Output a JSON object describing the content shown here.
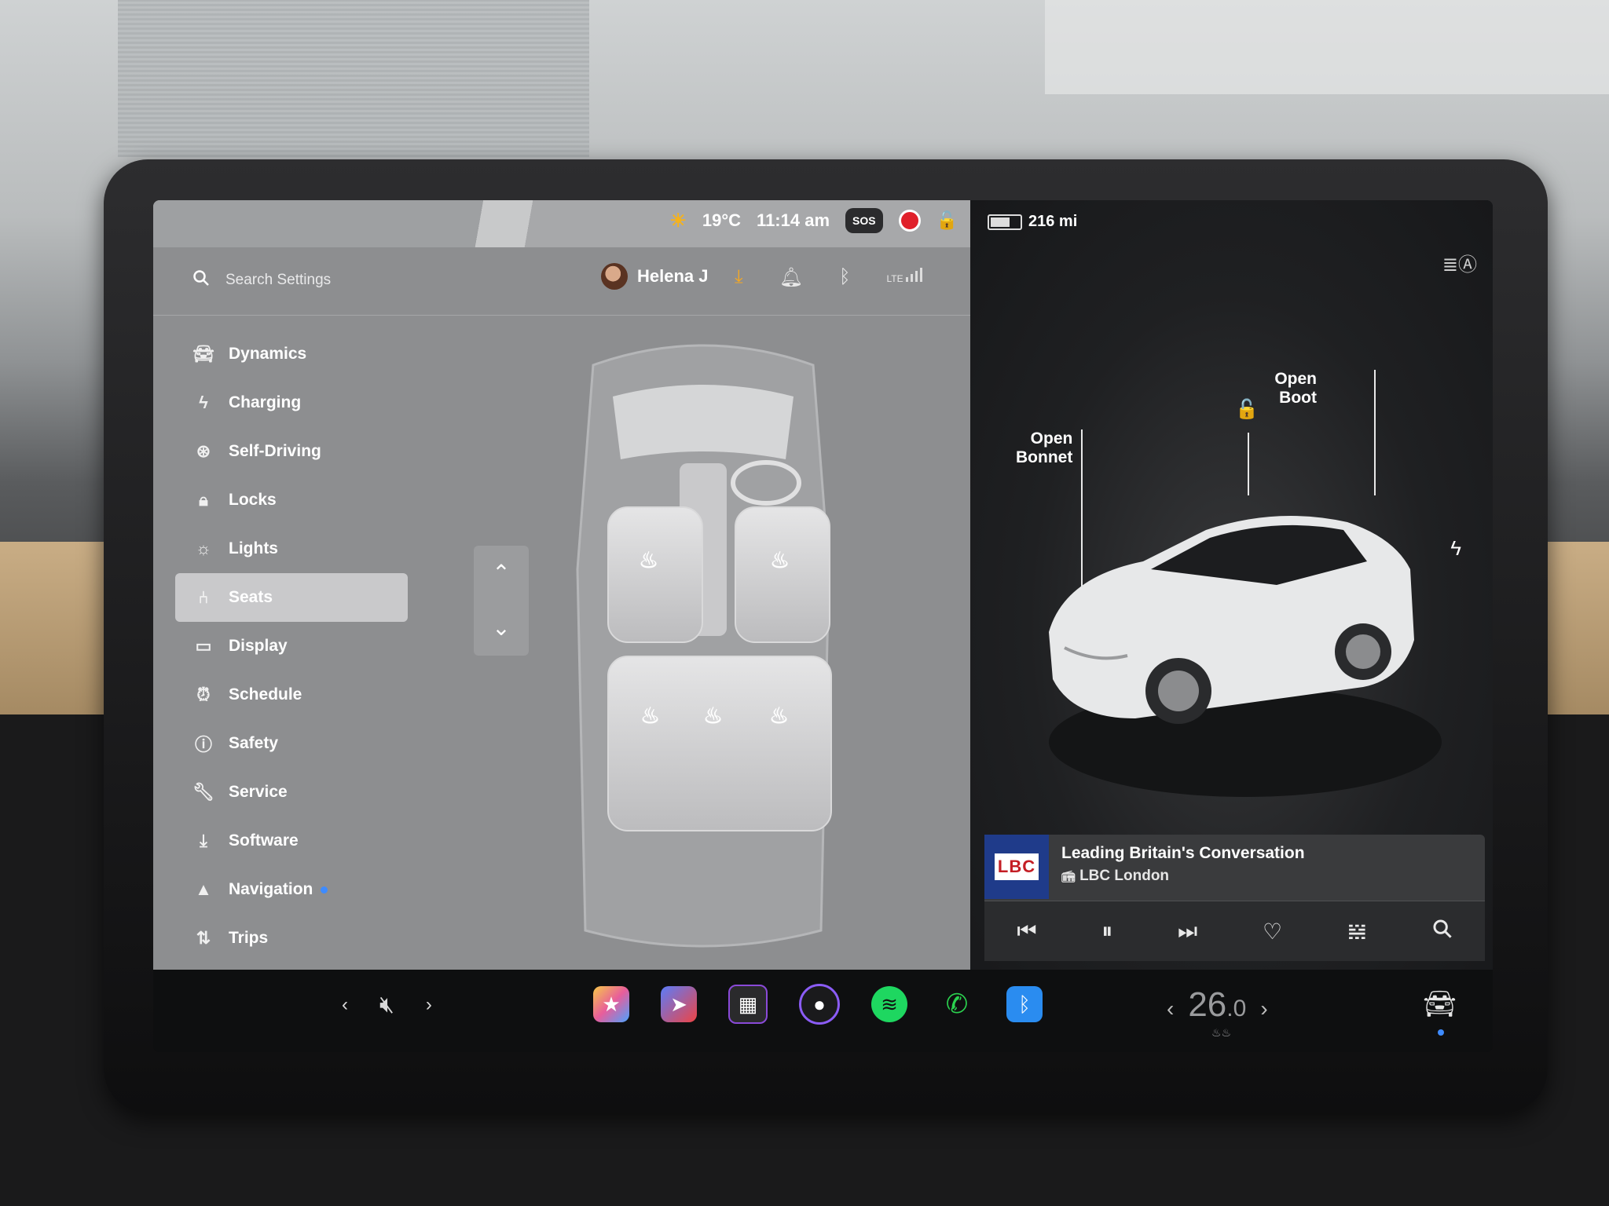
{
  "status": {
    "temperature": "19°C",
    "time": "11:14 am",
    "sos_label": "SOS",
    "range": "216 mi"
  },
  "settings_header": {
    "search_placeholder": "Search Settings",
    "user_name": "Helena J",
    "lte_label": "LTE"
  },
  "menu": [
    {
      "label": "Dynamics",
      "icon": "car-icon"
    },
    {
      "label": "Charging",
      "icon": "bolt-icon"
    },
    {
      "label": "Self-Driving",
      "icon": "steering-wheel-icon"
    },
    {
      "label": "Locks",
      "icon": "lock-icon"
    },
    {
      "label": "Lights",
      "icon": "sun-icon"
    },
    {
      "label": "Seats",
      "icon": "seat-icon",
      "active": true
    },
    {
      "label": "Display",
      "icon": "display-icon"
    },
    {
      "label": "Schedule",
      "icon": "alarm-clock-icon"
    },
    {
      "label": "Safety",
      "icon": "exclamation-icon"
    },
    {
      "label": "Service",
      "icon": "wrench-icon"
    },
    {
      "label": "Software",
      "icon": "download-icon"
    },
    {
      "label": "Navigation",
      "icon": "nav-arrow-icon",
      "badge": true
    },
    {
      "label": "Trips",
      "icon": "trips-icon"
    }
  ],
  "vehicle": {
    "open_bonnet": "Open\nBonnet",
    "open_boot": "Open\nBoot"
  },
  "media": {
    "title": "Leading Britain's Conversation",
    "station": "LBC London",
    "logo_text": "LBC"
  },
  "dock": {
    "cabin_temp": "26",
    "cabin_temp_decimal": ".0"
  },
  "colors": {
    "accent_blue": "#3e8bff",
    "download_orange": "#f6a821",
    "record_red": "#e0202a",
    "spotify_green": "#1ed760",
    "phone_green": "#2bd24f"
  }
}
